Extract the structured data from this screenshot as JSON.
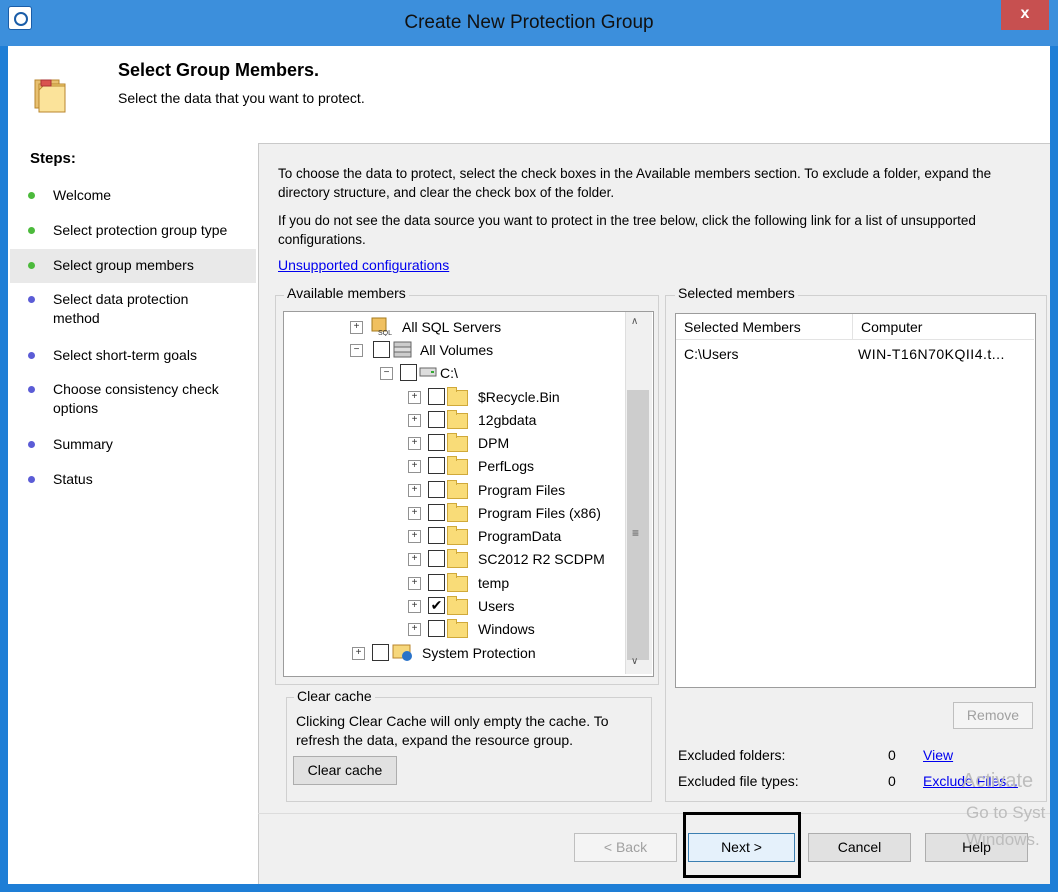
{
  "window": {
    "title": "Create New Protection Group",
    "close_label": "x"
  },
  "header": {
    "title": "Select Group Members.",
    "subtitle": "Select the data that you want to protect."
  },
  "steps": {
    "title": "Steps:",
    "items": [
      {
        "label": "Welcome",
        "status": "done"
      },
      {
        "label": "Select protection group type",
        "status": "done"
      },
      {
        "label": "Select group members",
        "status": "current"
      },
      {
        "label": "Select data protection method",
        "status": "pending"
      },
      {
        "label": "Select short-term goals",
        "status": "pending"
      },
      {
        "label": "Choose consistency check options",
        "status": "pending"
      },
      {
        "label": "Summary",
        "status": "pending"
      },
      {
        "label": "Status",
        "status": "pending"
      }
    ]
  },
  "main": {
    "intro1": "To choose the data to protect, select the check boxes in the Available members section. To exclude a folder, expand the directory structure, and clear the check box of the folder.",
    "intro2": "If you do not see the data source you want to protect in the tree below, click the following link for a list of unsupported configurations.",
    "unsupported_link": "Unsupported configurations"
  },
  "available": {
    "label": "Available members",
    "tree": [
      {
        "label": "All SQL Servers",
        "checked": false,
        "icon": "sql-server-icon"
      },
      {
        "label": "All Volumes",
        "checked": false,
        "icon": "volumes-icon"
      },
      {
        "label": "C:\\",
        "checked": false,
        "icon": "drive-icon"
      },
      {
        "label": "$Recycle.Bin",
        "checked": false,
        "icon": "folder-icon"
      },
      {
        "label": "12gbdata",
        "checked": false,
        "icon": "folder-icon"
      },
      {
        "label": "DPM",
        "checked": false,
        "icon": "folder-icon"
      },
      {
        "label": "PerfLogs",
        "checked": false,
        "icon": "folder-icon"
      },
      {
        "label": "Program Files",
        "checked": false,
        "icon": "folder-icon"
      },
      {
        "label": "Program Files (x86)",
        "checked": false,
        "icon": "folder-icon"
      },
      {
        "label": "ProgramData",
        "checked": false,
        "icon": "folder-icon"
      },
      {
        "label": "SC2012 R2 SCDPM",
        "checked": false,
        "icon": "folder-icon"
      },
      {
        "label": "temp",
        "checked": false,
        "icon": "folder-icon"
      },
      {
        "label": "Users",
        "checked": true,
        "icon": "folder-icon"
      },
      {
        "label": "Windows",
        "checked": false,
        "icon": "folder-icon"
      },
      {
        "label": "System Protection",
        "checked": false,
        "icon": "system-protection-icon"
      }
    ]
  },
  "cache": {
    "label": "Clear cache",
    "description": "Clicking Clear Cache will only empty the cache. To refresh the data, expand the resource group.",
    "button": "Clear cache"
  },
  "selected": {
    "label": "Selected members",
    "columns": [
      "Selected Members",
      "Computer"
    ],
    "rows": [
      {
        "member": "C:\\Users",
        "computer": "WIN-T16N70KQII4.t..."
      }
    ],
    "remove_button": "Remove",
    "excluded_folders_label": "Excluded folders:",
    "excluded_folders_count": "0",
    "view_link": "View",
    "excluded_types_label": "Excluded file types:",
    "excluded_types_count": "0",
    "exclude_files_link": "Exclude Files..."
  },
  "footer": {
    "back": "< Back",
    "next": "Next >",
    "cancel": "Cancel",
    "help": "Help"
  },
  "watermark": {
    "line1": "Activate",
    "line2": "Go to Syst",
    "line3": "Windows."
  },
  "colors": {
    "titlebar": "#3c8fdc",
    "close": "#c75050",
    "step_done": "#4cba3c",
    "step_pending": "#5b5cd6",
    "link": "#0000ee"
  }
}
